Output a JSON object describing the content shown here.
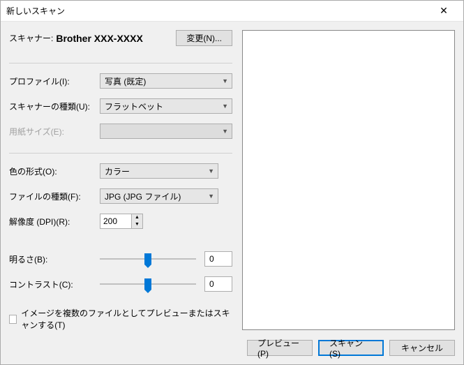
{
  "window": {
    "title": "新しいスキャン"
  },
  "scanner": {
    "label": "スキャナー:",
    "value": "Brother XXX-XXXX",
    "change_btn": "変更(N)..."
  },
  "profile": {
    "label": "プロファイル(I):",
    "value": "写真 (既定)"
  },
  "scanner_type": {
    "label": "スキャナーの種類(U):",
    "value": "フラットベット"
  },
  "paper_size": {
    "label": "用紙サイズ(E):",
    "value": ""
  },
  "color_format": {
    "label": "色の形式(O):",
    "value": "カラー"
  },
  "file_type": {
    "label": "ファイルの種類(F):",
    "value": "JPG (JPG ファイル)"
  },
  "resolution": {
    "label": "解像度 (DPI)(R):",
    "value": "200"
  },
  "brightness": {
    "label": "明るさ(B):",
    "value": "0"
  },
  "contrast": {
    "label": "コントラスト(C):",
    "value": "0"
  },
  "multi_file": {
    "label": "イメージを複数のファイルとしてプレビューまたはスキャンする(T)"
  },
  "footer": {
    "preview": "プレビュー(P)",
    "scan": "スキャン(S)",
    "cancel": "キャンセル"
  }
}
